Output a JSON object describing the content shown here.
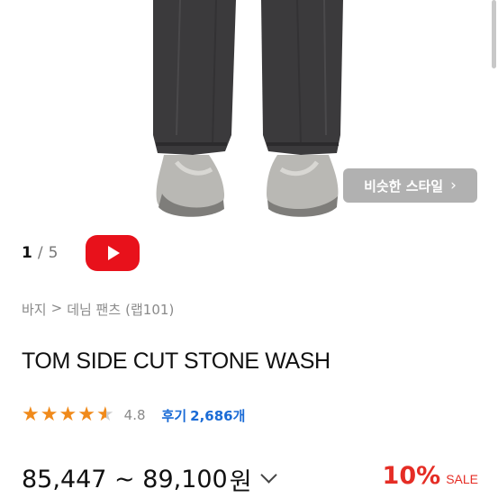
{
  "gallery": {
    "similar_style_label": "비슷한 스타일",
    "pager_current": "1",
    "pager_separator": "/",
    "pager_total": "5",
    "play_icon": "youtube-play-icon"
  },
  "breadcrumb": {
    "category": "바지",
    "separator": ">",
    "subcategory": "데님 팬츠",
    "brand": "(랩101)"
  },
  "product": {
    "title": "TOM SIDE CUT STONE WASH",
    "rating_value": "4.8",
    "rating_stars": 4.8,
    "reviews_prefix": "후기",
    "reviews_count": "2,686개",
    "price_range": "85,447 ~ 89,100",
    "price_currency": "원",
    "discount_percent": "10%",
    "discount_label": "SALE"
  },
  "colors": {
    "accent_red": "#e52d25",
    "link_blue": "#1a6bd6",
    "star_orange": "#f08a1b",
    "youtube_red": "#e8111b"
  }
}
